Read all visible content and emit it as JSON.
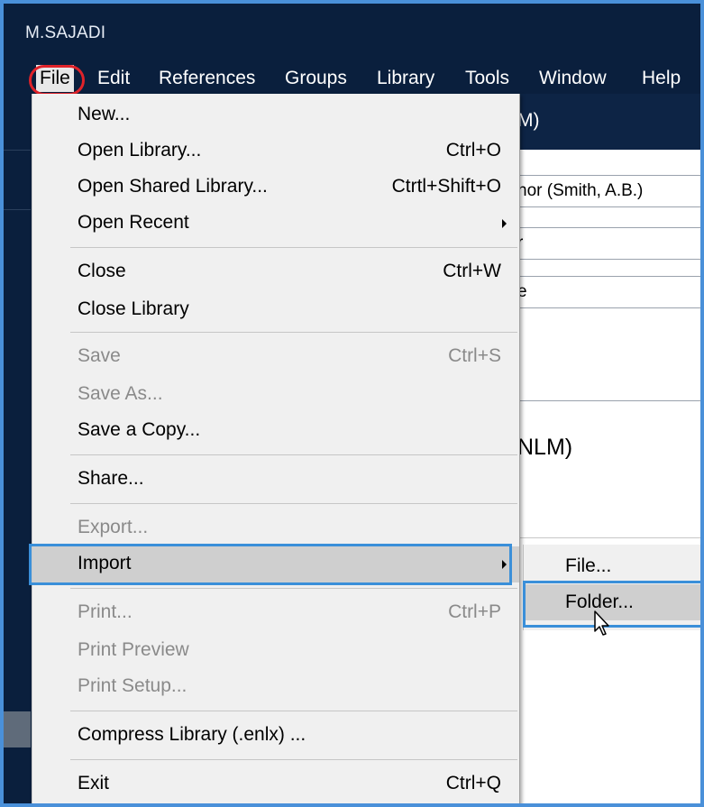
{
  "window": {
    "title": "M.SAJADI"
  },
  "menubar": {
    "items": [
      "File",
      "Edit",
      "References",
      "Groups",
      "Library",
      "Tools",
      "Window",
      "Help"
    ]
  },
  "background": {
    "tab_text": "M)",
    "author_field": "hor (Smith, A.B.)",
    "field_2": "r",
    "field_3": "e",
    "heading": "NLM)"
  },
  "file_menu": {
    "new": "New...",
    "open_library": "Open Library...",
    "open_library_acc": "Ctrl+O",
    "open_shared": "Open Shared Library...",
    "open_shared_acc": "Ctrtl+Shift+O",
    "open_recent": "Open Recent",
    "close": "Close",
    "close_acc": "Ctrl+W",
    "close_library": "Close Library",
    "save": "Save",
    "save_acc": "Ctrl+S",
    "save_as": "Save As...",
    "save_copy": "Save a Copy...",
    "share": "Share...",
    "export": "Export...",
    "import": "Import",
    "print": "Print...",
    "print_acc": "Ctrl+P",
    "print_preview": "Print Preview",
    "print_setup": "Print Setup...",
    "compress": "Compress Library (.enlx) ...",
    "exit": "Exit",
    "exit_acc": "Ctrl+Q"
  },
  "import_submenu": {
    "file": "File...",
    "folder": "Folder..."
  },
  "colors": {
    "app_dark": "#0a1f3d",
    "highlight_frame": "#3a8fd9",
    "file_circle": "#e0232a",
    "menu_bg": "#f0f0f0"
  }
}
